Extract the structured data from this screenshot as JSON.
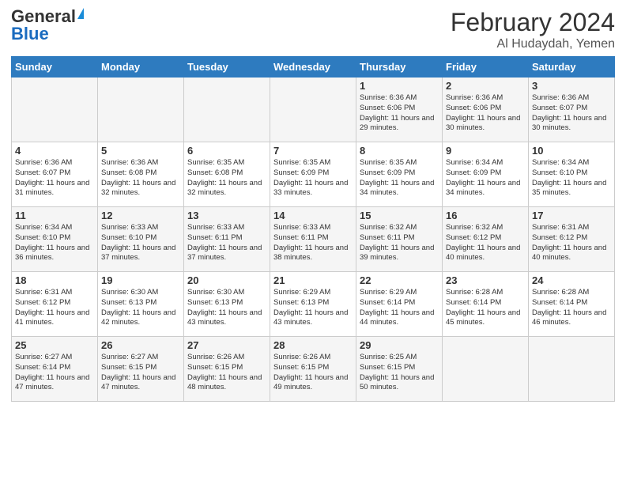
{
  "header": {
    "logo_general": "General",
    "logo_blue": "Blue",
    "title": "February 2024",
    "subtitle": "Al Hudaydah, Yemen"
  },
  "weekdays": [
    "Sunday",
    "Monday",
    "Tuesday",
    "Wednesday",
    "Thursday",
    "Friday",
    "Saturday"
  ],
  "weeks": [
    [
      {
        "day": "",
        "info": ""
      },
      {
        "day": "",
        "info": ""
      },
      {
        "day": "",
        "info": ""
      },
      {
        "day": "",
        "info": ""
      },
      {
        "day": "1",
        "sunrise": "6:36 AM",
        "sunset": "6:06 PM",
        "daylight": "11 hours and 29 minutes."
      },
      {
        "day": "2",
        "sunrise": "6:36 AM",
        "sunset": "6:06 PM",
        "daylight": "11 hours and 30 minutes."
      },
      {
        "day": "3",
        "sunrise": "6:36 AM",
        "sunset": "6:07 PM",
        "daylight": "11 hours and 30 minutes."
      }
    ],
    [
      {
        "day": "4",
        "sunrise": "6:36 AM",
        "sunset": "6:07 PM",
        "daylight": "11 hours and 31 minutes."
      },
      {
        "day": "5",
        "sunrise": "6:36 AM",
        "sunset": "6:08 PM",
        "daylight": "11 hours and 32 minutes."
      },
      {
        "day": "6",
        "sunrise": "6:35 AM",
        "sunset": "6:08 PM",
        "daylight": "11 hours and 32 minutes."
      },
      {
        "day": "7",
        "sunrise": "6:35 AM",
        "sunset": "6:09 PM",
        "daylight": "11 hours and 33 minutes."
      },
      {
        "day": "8",
        "sunrise": "6:35 AM",
        "sunset": "6:09 PM",
        "daylight": "11 hours and 34 minutes."
      },
      {
        "day": "9",
        "sunrise": "6:34 AM",
        "sunset": "6:09 PM",
        "daylight": "11 hours and 34 minutes."
      },
      {
        "day": "10",
        "sunrise": "6:34 AM",
        "sunset": "6:10 PM",
        "daylight": "11 hours and 35 minutes."
      }
    ],
    [
      {
        "day": "11",
        "sunrise": "6:34 AM",
        "sunset": "6:10 PM",
        "daylight": "11 hours and 36 minutes."
      },
      {
        "day": "12",
        "sunrise": "6:33 AM",
        "sunset": "6:10 PM",
        "daylight": "11 hours and 37 minutes."
      },
      {
        "day": "13",
        "sunrise": "6:33 AM",
        "sunset": "6:11 PM",
        "daylight": "11 hours and 37 minutes."
      },
      {
        "day": "14",
        "sunrise": "6:33 AM",
        "sunset": "6:11 PM",
        "daylight": "11 hours and 38 minutes."
      },
      {
        "day": "15",
        "sunrise": "6:32 AM",
        "sunset": "6:11 PM",
        "daylight": "11 hours and 39 minutes."
      },
      {
        "day": "16",
        "sunrise": "6:32 AM",
        "sunset": "6:12 PM",
        "daylight": "11 hours and 40 minutes."
      },
      {
        "day": "17",
        "sunrise": "6:31 AM",
        "sunset": "6:12 PM",
        "daylight": "11 hours and 40 minutes."
      }
    ],
    [
      {
        "day": "18",
        "sunrise": "6:31 AM",
        "sunset": "6:12 PM",
        "daylight": "11 hours and 41 minutes."
      },
      {
        "day": "19",
        "sunrise": "6:30 AM",
        "sunset": "6:13 PM",
        "daylight": "11 hours and 42 minutes."
      },
      {
        "day": "20",
        "sunrise": "6:30 AM",
        "sunset": "6:13 PM",
        "daylight": "11 hours and 43 minutes."
      },
      {
        "day": "21",
        "sunrise": "6:29 AM",
        "sunset": "6:13 PM",
        "daylight": "11 hours and 43 minutes."
      },
      {
        "day": "22",
        "sunrise": "6:29 AM",
        "sunset": "6:14 PM",
        "daylight": "11 hours and 44 minutes."
      },
      {
        "day": "23",
        "sunrise": "6:28 AM",
        "sunset": "6:14 PM",
        "daylight": "11 hours and 45 minutes."
      },
      {
        "day": "24",
        "sunrise": "6:28 AM",
        "sunset": "6:14 PM",
        "daylight": "11 hours and 46 minutes."
      }
    ],
    [
      {
        "day": "25",
        "sunrise": "6:27 AM",
        "sunset": "6:14 PM",
        "daylight": "11 hours and 47 minutes."
      },
      {
        "day": "26",
        "sunrise": "6:27 AM",
        "sunset": "6:15 PM",
        "daylight": "11 hours and 47 minutes."
      },
      {
        "day": "27",
        "sunrise": "6:26 AM",
        "sunset": "6:15 PM",
        "daylight": "11 hours and 48 minutes."
      },
      {
        "day": "28",
        "sunrise": "6:26 AM",
        "sunset": "6:15 PM",
        "daylight": "11 hours and 49 minutes."
      },
      {
        "day": "29",
        "sunrise": "6:25 AM",
        "sunset": "6:15 PM",
        "daylight": "11 hours and 50 minutes."
      },
      {
        "day": "",
        "info": ""
      },
      {
        "day": "",
        "info": ""
      }
    ]
  ]
}
